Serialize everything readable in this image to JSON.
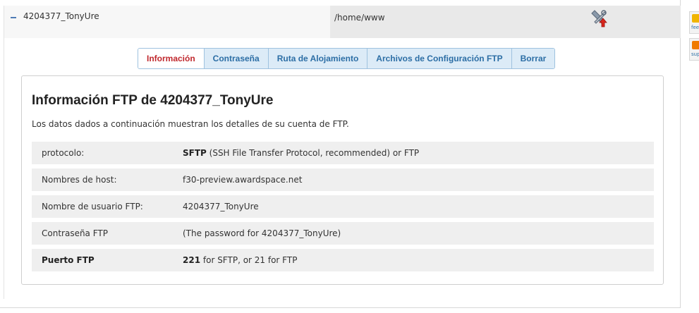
{
  "account": {
    "name": "4204377_TonyUre",
    "path": "/home/www"
  },
  "icons": {
    "collapse": "minus-icon",
    "tools": "tools-upload-icon",
    "feedback": "feedback-icon",
    "support": "support-icon"
  },
  "tabs": [
    {
      "label": "Información",
      "active": true
    },
    {
      "label": "Contraseña",
      "active": false
    },
    {
      "label": "Ruta de Alojamiento",
      "active": false
    },
    {
      "label": "Archivos de Configuración FTP",
      "active": false
    },
    {
      "label": "Borrar",
      "active": false
    }
  ],
  "panel": {
    "title": "Información FTP de 4204377_TonyUre",
    "description": "Los datos dados a continuación muestran los detalles de su cuenta de FTP.",
    "rows": [
      {
        "label": "protocolo:",
        "value_bold": "SFTP",
        "value_rest": " (SSH File Transfer Protocol, recommended) or FTP"
      },
      {
        "label": "Nombres de host:",
        "value": "f30-preview.awardspace.net"
      },
      {
        "label": "Nombre de usuario FTP:",
        "value": "4204377_TonyUre"
      },
      {
        "label": "Contraseña FTP",
        "value": "(The password for 4204377_TonyUre)"
      },
      {
        "label": "Puerto FTP",
        "value_bold": "221",
        "value_rest": " for SFTP, or 21 for FTP"
      }
    ]
  },
  "side": {
    "feedback_label": "fee",
    "support_label": "sup"
  },
  "colors": {
    "tab_active_text": "#c0282d",
    "tab_text": "#2c6ea5",
    "tab_bg": "#dcebf7",
    "tab_border": "#9fc2df",
    "row_bg": "#efefef"
  }
}
